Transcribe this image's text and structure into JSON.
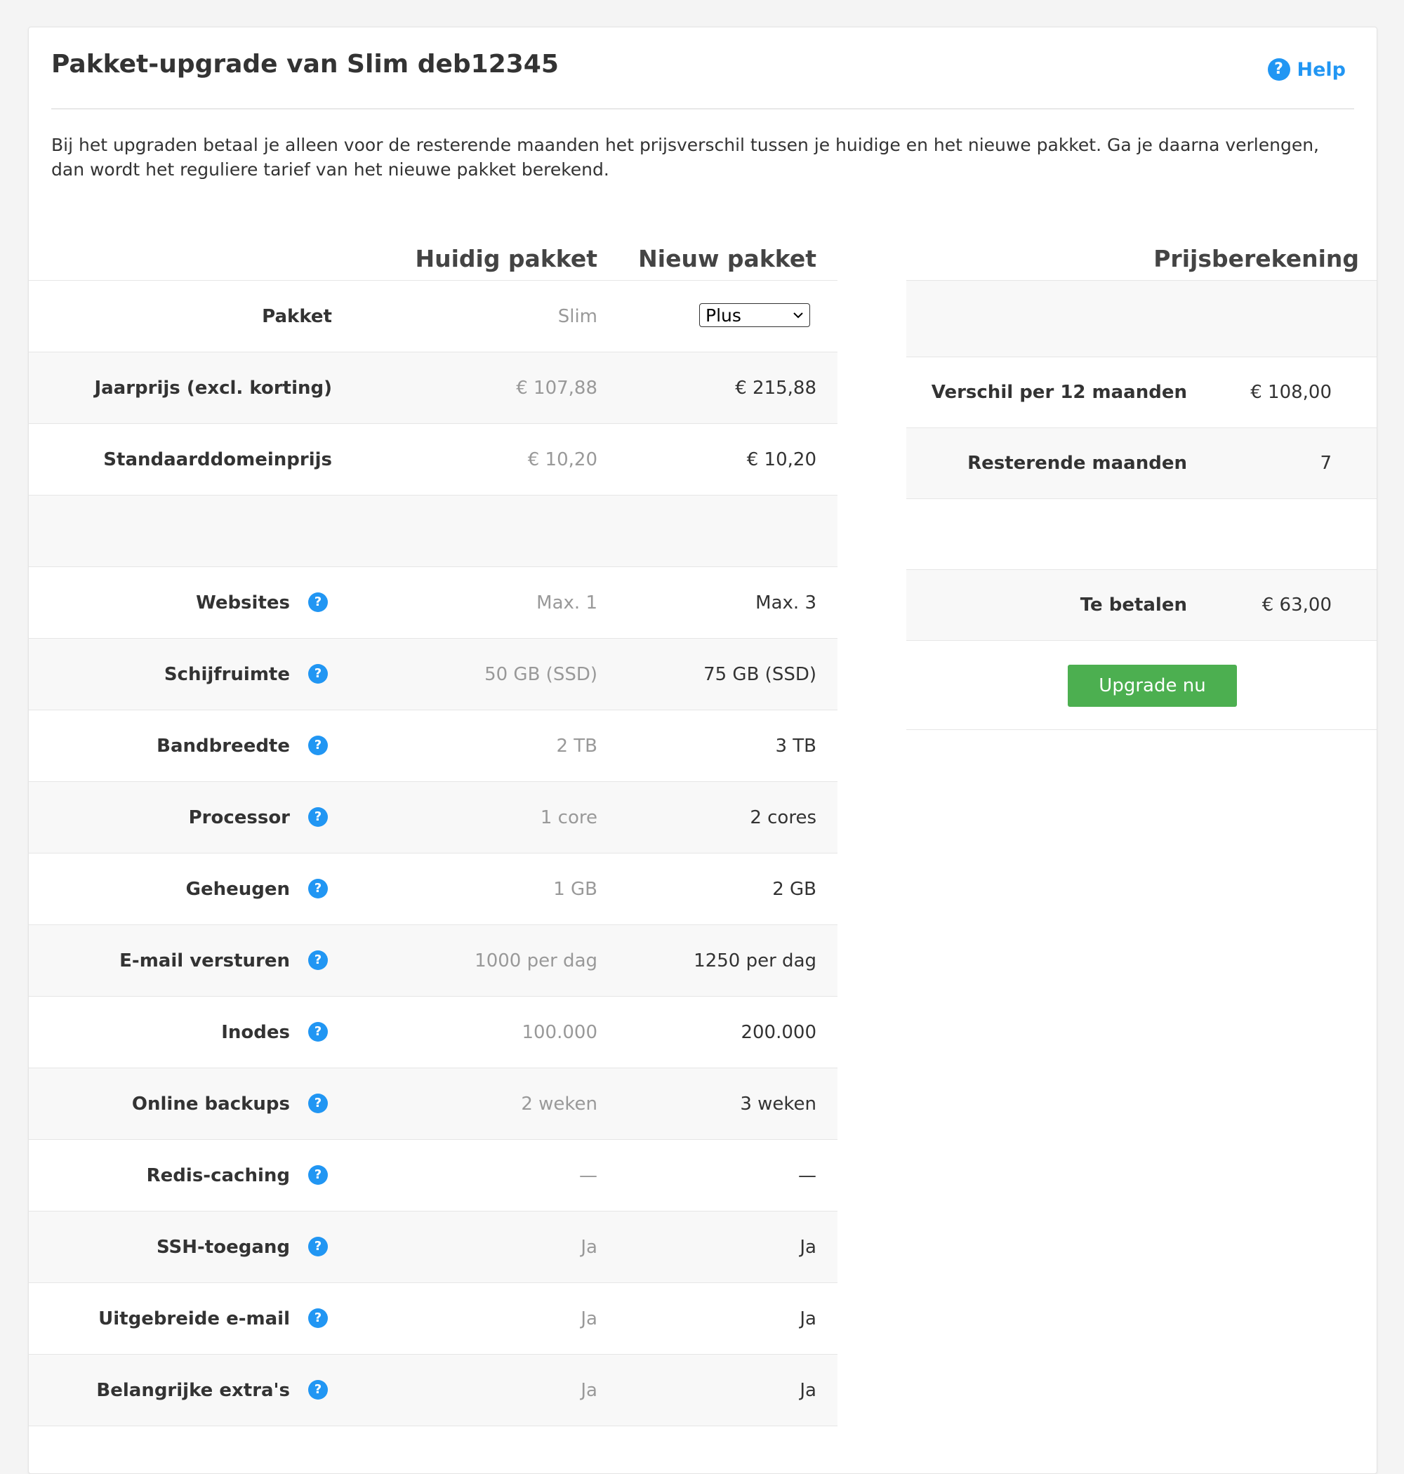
{
  "card": {
    "title": "Pakket-upgrade van Slim deb12345",
    "help_label": "Help",
    "intro": "Bij het upgraden betaal je alleen voor de resterende maanden het prijsverschil tussen je huidige en het nieuwe pakket. Ga je daarna verlengen, dan wordt het reguliere tarief van het nieuwe pakket berekend."
  },
  "columns": {
    "current": "Huidig pakket",
    "new": "Nieuw pakket",
    "price": "Prijsberekening"
  },
  "package_row": {
    "label": "Pakket",
    "current": "Slim",
    "new_selected": "Plus"
  },
  "price_rows": [
    {
      "label": "Jaarprijs (excl. korting)",
      "current": "€ 107,88",
      "new": "€ 215,88"
    },
    {
      "label": "Standaarddomeinprijs",
      "current": "€ 10,20",
      "new": "€ 10,20"
    }
  ],
  "features": [
    {
      "label": "Websites",
      "current": "Max. 1",
      "new": "Max. 3"
    },
    {
      "label": "Schijfruimte",
      "current": "50 GB (SSD)",
      "new": "75 GB (SSD)"
    },
    {
      "label": "Bandbreedte",
      "current": "2 TB",
      "new": "3 TB"
    },
    {
      "label": "Processor",
      "current": "1 core",
      "new": "2 cores"
    },
    {
      "label": "Geheugen",
      "current": "1 GB",
      "new": "2 GB"
    },
    {
      "label": "E-mail versturen",
      "current": "1000 per dag",
      "new": "1250 per dag"
    },
    {
      "label": "Inodes",
      "current": "100.000",
      "new": "200.000"
    },
    {
      "label": "Online backups",
      "current": "2 weken",
      "new": "3 weken"
    },
    {
      "label": "Redis-caching",
      "current": "—",
      "new": "—"
    },
    {
      "label": "SSH-toegang",
      "current": "Ja",
      "new": "Ja"
    },
    {
      "label": "Uitgebreide e-mail",
      "current": "Ja",
      "new": "Ja"
    },
    {
      "label": "Belangrijke extra's",
      "current": "Ja",
      "new": "Ja"
    }
  ],
  "calculation": {
    "diff_label": "Verschil per 12 maanden",
    "diff_value": "€ 108,00",
    "months_label": "Resterende maanden",
    "months_value": "7",
    "pay_label": "Te betalen",
    "pay_value": "€ 63,00",
    "button_label": "Upgrade nu"
  },
  "help_icon_glyph": "?",
  "colors": {
    "accent": "#2196f3",
    "button": "#4caf50"
  }
}
